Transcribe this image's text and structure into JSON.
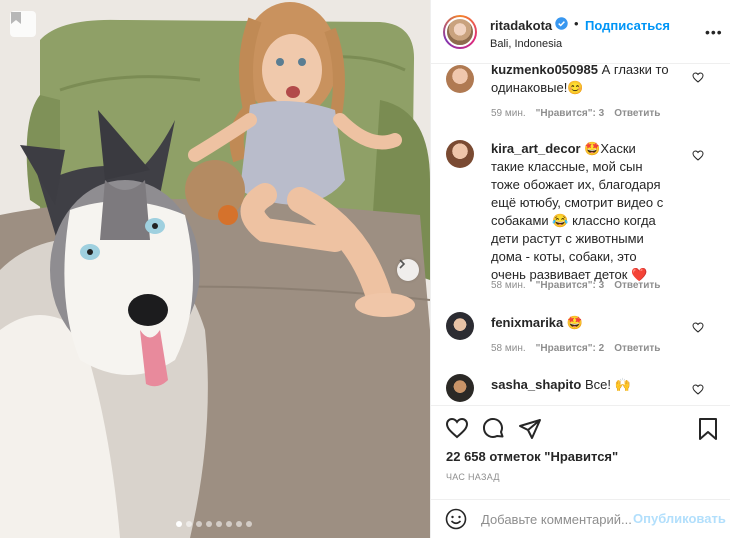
{
  "post": {
    "username": "ritadakota",
    "verified": true,
    "separator": "•",
    "follow_label": "Подписаться",
    "location": "Bali, Indonesia",
    "more_label": "•••"
  },
  "carousel": {
    "slide_count": 8,
    "active_index": 0
  },
  "comments": [
    {
      "username": "kuzmenko050985",
      "text": "А глазки то одинаковые!😊",
      "time": "59 мин.",
      "likes": "\"Нравится\": 3",
      "reply": "Ответить"
    },
    {
      "username": "kira_art_decor",
      "text": "🤩Хаски такие классные, мой сын тоже обожает их, благодаря ещё ютюбу, смотрит видео с собаками 😂 классно когда дети растут с животными дома - коты, собаки, это очень развивает деток ❤️",
      "time": "58 мин.",
      "likes": "\"Нравится\": 3",
      "reply": "Ответить"
    },
    {
      "username": "fenixmarika",
      "text": "🤩",
      "time": "58 мин.",
      "likes": "\"Нравится\": 2",
      "reply": "Ответить"
    },
    {
      "username": "sasha_shapito",
      "text": "Все! 🙌",
      "time": "",
      "likes": "",
      "reply": ""
    }
  ],
  "actions": {
    "likes_text": "22 658 отметок \"Нравится\"",
    "posted_ago": "ЧАС НАЗАД"
  },
  "composer": {
    "placeholder": "Добавьте комментарий...",
    "publish_label": "Опубликовать"
  },
  "colors": {
    "link_blue": "#0095f6",
    "publish_disabled": "#b2dffc",
    "muted": "#8e8e8e",
    "text": "#262626",
    "heart_red": "#ed4956"
  }
}
